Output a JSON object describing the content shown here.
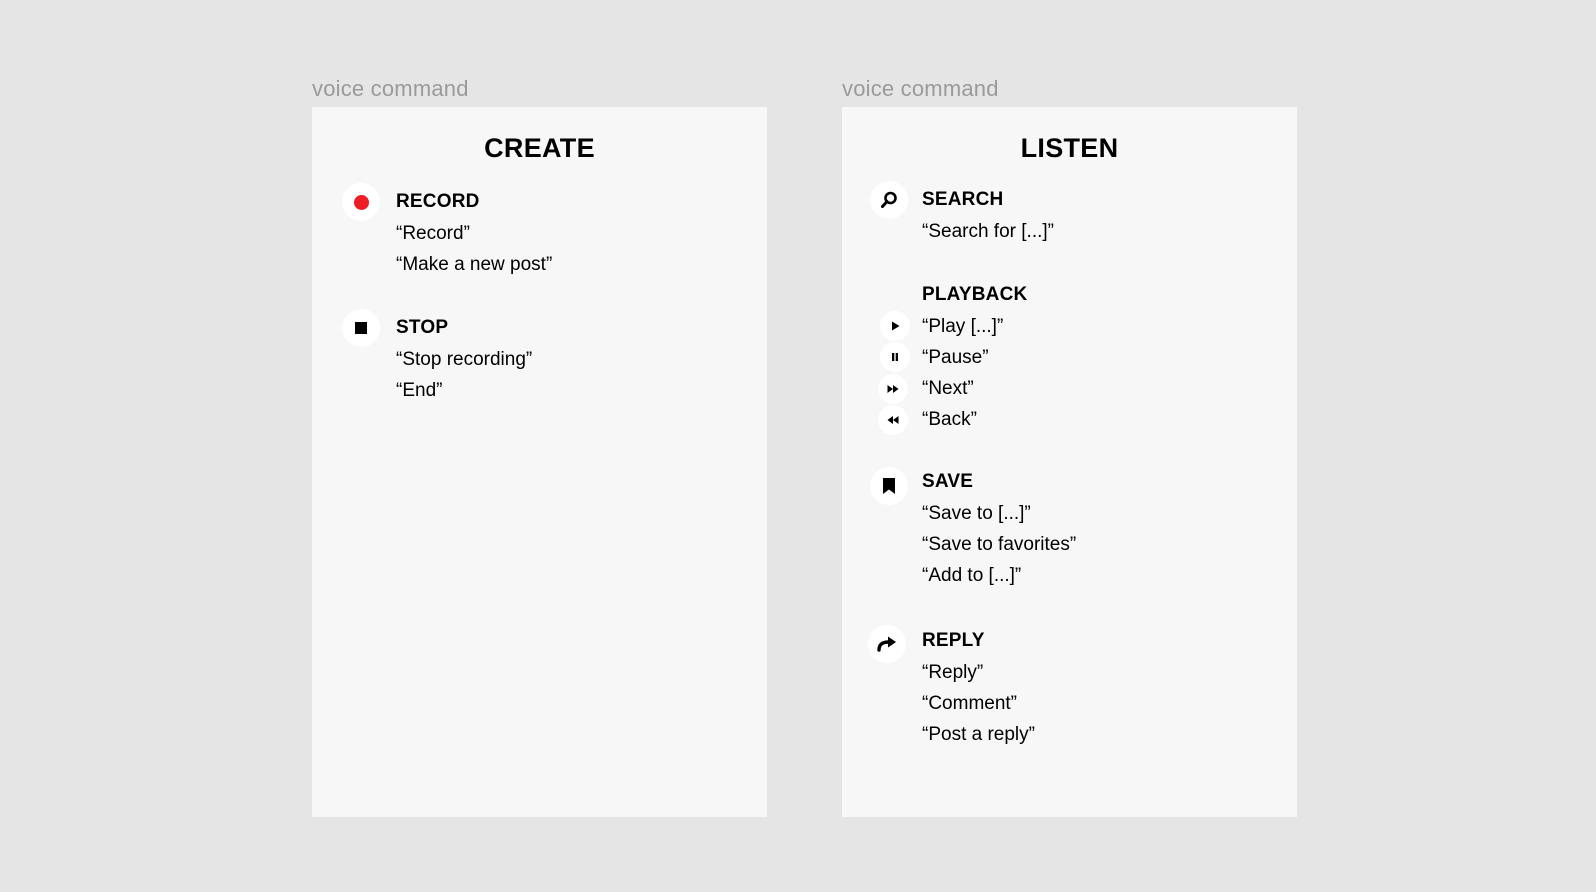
{
  "frames": [
    {
      "label": "voice command",
      "title": "CREATE",
      "record": {
        "heading": "RECORD",
        "phrases": [
          "“Record”",
          "“Make a new post”"
        ],
        "icon": "record-icon",
        "icon_color": "#ee1c25"
      },
      "stop": {
        "heading": "STOP",
        "phrases": [
          "“Stop recording”",
          "“End”"
        ],
        "icon": "stop-icon"
      }
    },
    {
      "label": "voice command",
      "title": "LISTEN",
      "search": {
        "heading": "SEARCH",
        "phrases": [
          "“Search for [...]”"
        ],
        "icon": "search-icon"
      },
      "playback": {
        "heading": "PLAYBACK",
        "items": [
          {
            "phrase": "“Play [...]”",
            "icon": "play-icon"
          },
          {
            "phrase": "“Pause”",
            "icon": "pause-icon"
          },
          {
            "phrase": "“Next”",
            "icon": "fast-forward-icon"
          },
          {
            "phrase": "“Back”",
            "icon": "rewind-icon"
          }
        ]
      },
      "save": {
        "heading": "SAVE",
        "phrases": [
          "“Save to [...]”",
          "“Save to favorites”",
          "“Add to [...]”"
        ],
        "icon": "bookmark-icon"
      },
      "reply": {
        "heading": "REPLY",
        "phrases": [
          "“Reply”",
          "“Comment”",
          "“Post a reply”"
        ],
        "icon": "reply-icon"
      }
    }
  ],
  "colors": {
    "background": "#e5e5e5",
    "card": "#f7f7f7",
    "label": "#9a9a9a",
    "record": "#ee1c25"
  }
}
